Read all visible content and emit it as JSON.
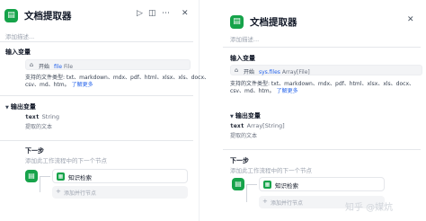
{
  "left_panel": {
    "header": {
      "icon": "file-extractor-icon",
      "title": "文档提取器",
      "run_icon": "play-icon",
      "layout_icon": "panel-icon",
      "more_icon": "more-icon",
      "close_icon": "close-icon"
    },
    "description_placeholder": "添加描述...",
    "input_section": {
      "title": "输入变量",
      "pin_icon": "pin-icon",
      "source_node": "开始",
      "variable": "file",
      "variable_type": "File",
      "supported_types": "支持的文件类型: txt、markdown、mdx、pdf、html、xlsx、xls、docx、csv、md、htm。",
      "learn_more": "了解更多"
    },
    "output_section": {
      "title": "输出变量",
      "output_name": "text",
      "output_type": "String",
      "output_desc": "提取的文本"
    },
    "next_step": {
      "title": "下一步",
      "subtitle": "添加此工作流程中的下一个节点",
      "next_node_label": "知识检索",
      "add_branch_label": "添加并行节点"
    }
  },
  "right_panel": {
    "header": {
      "icon": "file-extractor-icon",
      "title": "文档提取器",
      "close_icon": "close-icon"
    },
    "description_placeholder": "添加描述...",
    "input_section": {
      "title": "输入变量",
      "pin_icon": "pin-icon",
      "source_node": "开始",
      "variable": "sys.files",
      "variable_type": "Array[File]",
      "supported_types": "支持的文件类型: txt、markdown、mdx、pdf、html、xlsx、xls、docx、csv、md、htm。",
      "learn_more": "了解更多"
    },
    "output_section": {
      "title": "输出变量",
      "output_name": "text",
      "output_type": "Array[String]",
      "output_desc": "提取的文本"
    },
    "next_step": {
      "title": "下一步",
      "subtitle": "添加此工作流程中的下一个节点",
      "next_node_label": "知识检索",
      "add_branch_label": "添加并行节点"
    }
  },
  "watermark": "知乎 @媒炕",
  "colors": {
    "accent_green": "#16a34a",
    "link_blue": "#2563eb"
  }
}
